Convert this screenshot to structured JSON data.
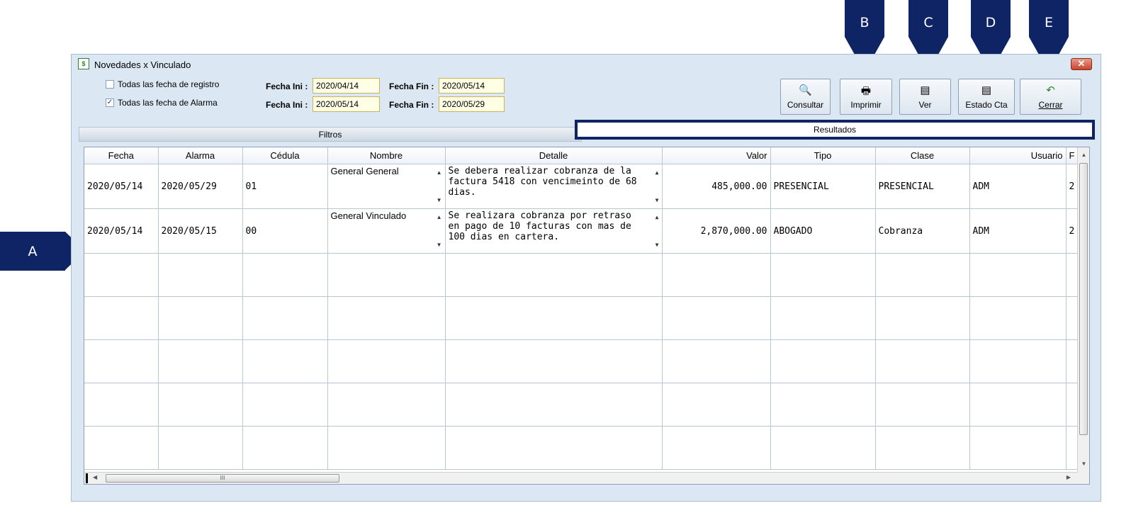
{
  "callouts": [
    "A",
    "B",
    "C",
    "D",
    "E"
  ],
  "window": {
    "title": "Novedades x Vinculado",
    "close_label": "✕"
  },
  "filters": {
    "registro": {
      "label": "Todas las fecha de registro",
      "checked": false,
      "ini_label": "Fecha Ini :",
      "ini": "2020/04/14",
      "fin_label": "Fecha Fin :",
      "fin": "2020/05/14"
    },
    "alarma": {
      "label": "Todas las fecha de Alarma",
      "checked": true,
      "ini_label": "Fecha Ini :",
      "ini": "2020/05/14",
      "fin_label": "Fecha Fin :",
      "fin": "2020/05/29"
    }
  },
  "toolbar": {
    "consultar": "Consultar",
    "imprimir": "Imprimir",
    "ver": "Ver",
    "estado": "Estado Cta",
    "cerrar": "Cerrar"
  },
  "tabs": {
    "filtros": "Filtros",
    "resultados": "Resultados"
  },
  "grid": {
    "headers": [
      "Fecha",
      "Alarma",
      "Cédula",
      "Nombre",
      "Detalle",
      "Valor",
      "Tipo",
      "Clase",
      "Usuario",
      "F"
    ],
    "rows": [
      {
        "fecha": "2020/05/14",
        "alarma": "2020/05/29",
        "cedula": "01",
        "nombre": "General General",
        "detalle": "Se debera realizar cobranza de la factura 5418 con vencimeinto de 68 dias.",
        "valor": "485,000.00",
        "tipo": "PRESENCIAL",
        "clase": "PRESENCIAL",
        "usuario": "ADM",
        "f": "2"
      },
      {
        "fecha": "2020/05/14",
        "alarma": "2020/05/15",
        "cedula": "00",
        "nombre": "General Vinculado",
        "detalle": "Se realizara cobranza por retraso en pago de 10 facturas con mas de 100 dias en cartera.",
        "valor": "2,870,000.00",
        "tipo": "ABOGADO",
        "clase": "Cobranza",
        "usuario": "ADM",
        "f": "2"
      }
    ],
    "hscroll_grip": "III"
  }
}
